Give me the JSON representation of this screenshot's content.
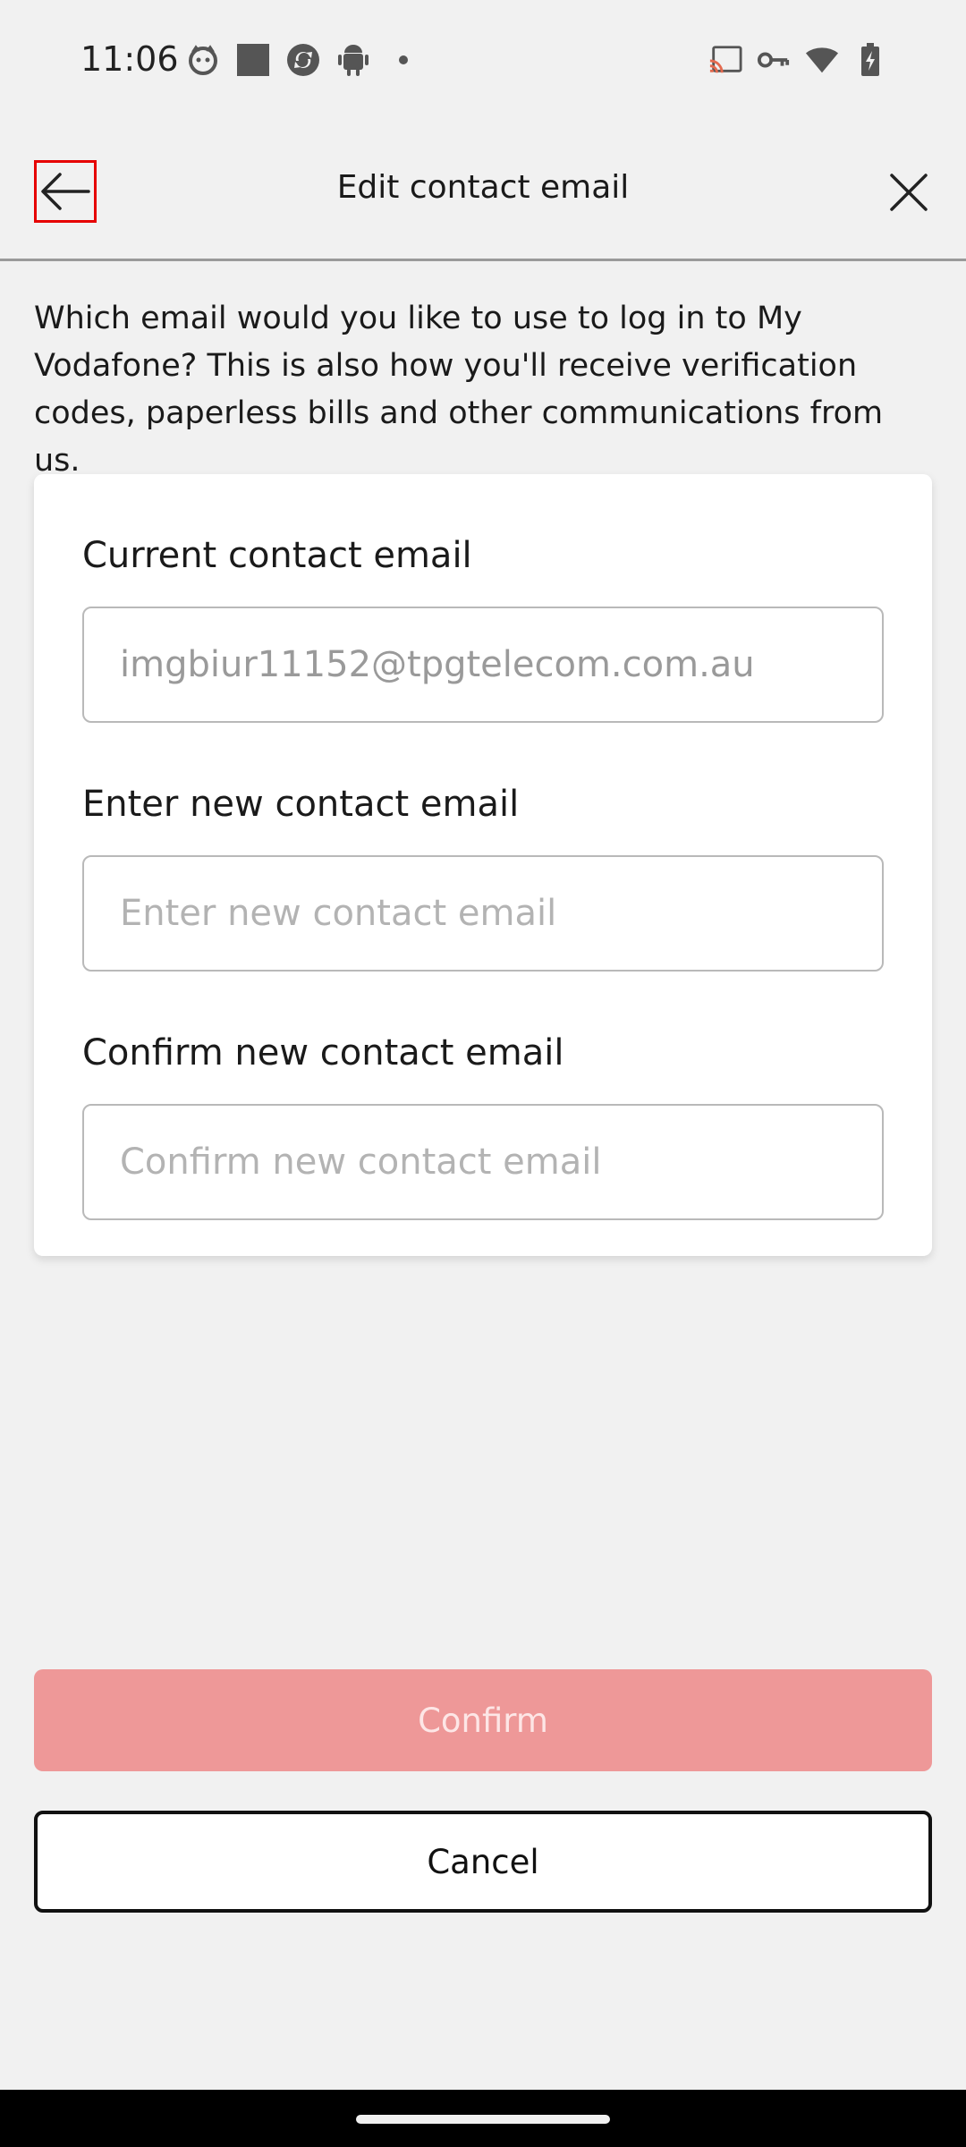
{
  "status_bar": {
    "time": "11:06",
    "left_icons": [
      "cat-face-icon",
      "square-icon",
      "sync-badge-icon",
      "android-icon",
      "dot-icon"
    ],
    "right_icons": [
      "cast-icon",
      "vpn-key-icon",
      "wifi-icon",
      "battery-charging-icon"
    ]
  },
  "header": {
    "title": "Edit contact email",
    "back_icon": "arrow-left-icon",
    "close_icon": "close-icon"
  },
  "intro_text": "Which email would you like to use to log in to My Vodafone? This is also how you'll receive verification codes, paperless bills and other communications from us.",
  "form": {
    "current": {
      "label": "Current contact email",
      "value": "imgbiur11152@tpgtelecom.com.au"
    },
    "new_email": {
      "label": "Enter new contact email",
      "value": "",
      "placeholder": "Enter new contact email"
    },
    "confirm_email": {
      "label": "Confirm new contact email",
      "value": "",
      "placeholder": "Confirm new contact email"
    }
  },
  "buttons": {
    "confirm": "Confirm",
    "cancel": "Cancel"
  },
  "colors": {
    "brand_red": "#e60000",
    "confirm_disabled_bg": "#ee9898",
    "background": "#f1f1f1"
  }
}
